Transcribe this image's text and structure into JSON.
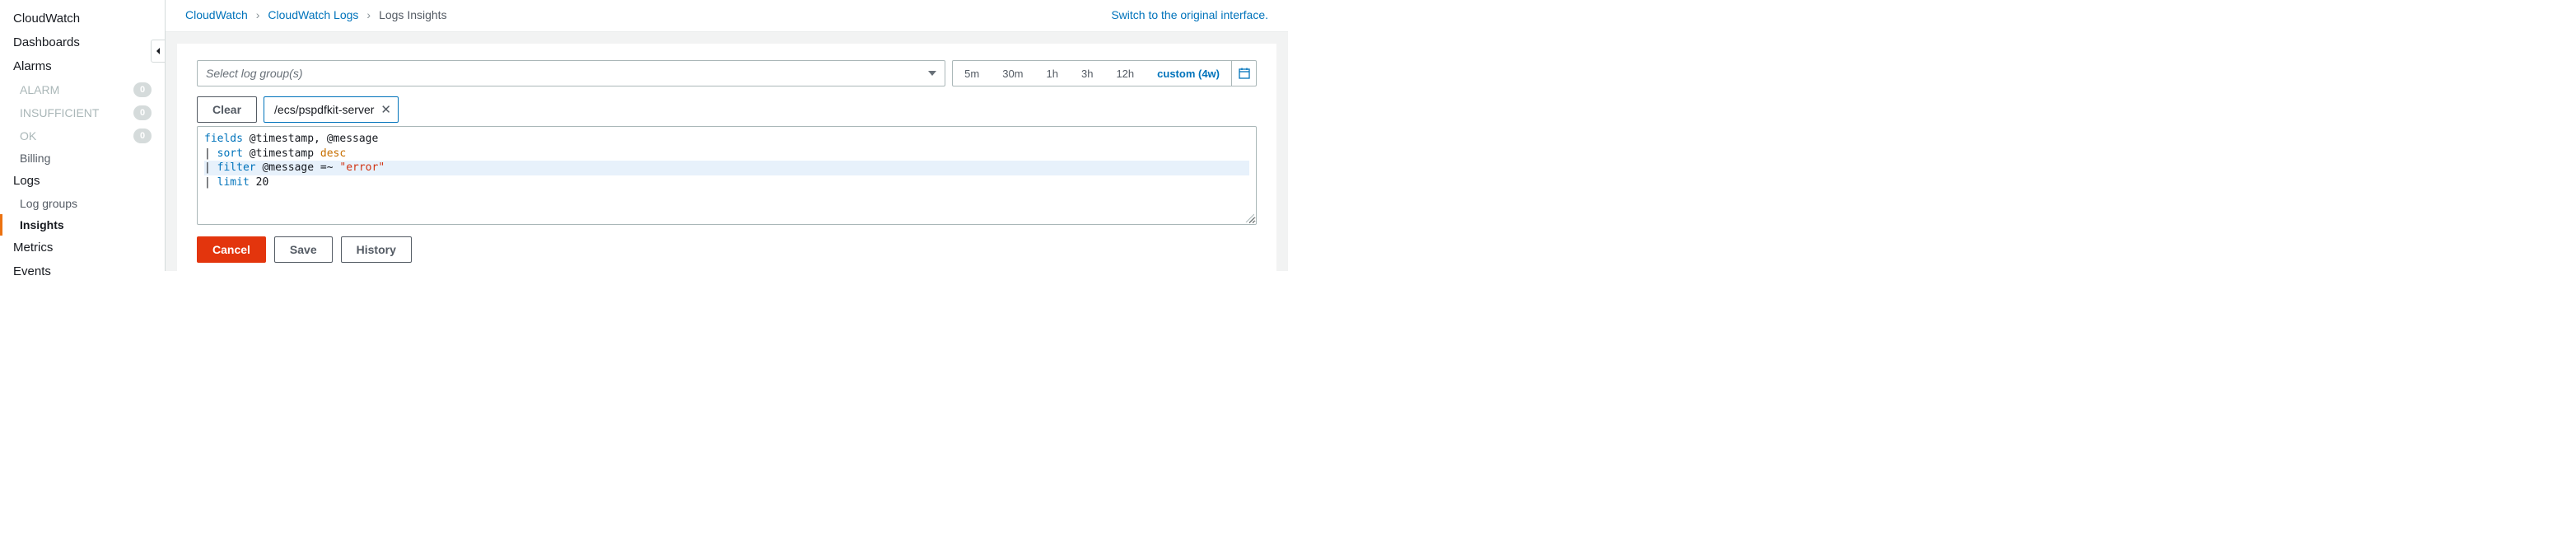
{
  "sidebar": {
    "items": [
      {
        "label": "CloudWatch",
        "type": "item"
      },
      {
        "label": "Dashboards",
        "type": "item"
      },
      {
        "label": "Alarms",
        "type": "item"
      },
      {
        "label": "ALARM",
        "type": "sub-disabled",
        "count": "0"
      },
      {
        "label": "INSUFFICIENT",
        "type": "sub-disabled",
        "count": "0"
      },
      {
        "label": "OK",
        "type": "sub-disabled",
        "count": "0"
      },
      {
        "label": "Billing",
        "type": "sub"
      },
      {
        "label": "Logs",
        "type": "item"
      },
      {
        "label": "Log groups",
        "type": "sub"
      },
      {
        "label": "Insights",
        "type": "sub-active"
      },
      {
        "label": "Metrics",
        "type": "item"
      },
      {
        "label": "Events",
        "type": "item"
      }
    ]
  },
  "breadcrumb": {
    "items": [
      "CloudWatch",
      "CloudWatch Logs",
      "Logs Insights"
    ]
  },
  "top_link": "Switch to the original interface.",
  "log_select": {
    "placeholder": "Select log group(s)"
  },
  "time_range": {
    "options": [
      "5m",
      "30m",
      "1h",
      "3h",
      "12h"
    ],
    "custom": "custom (4w)"
  },
  "clear_label": "Clear",
  "chip": {
    "label": "/ecs/pspdfkit-server"
  },
  "query": {
    "line1": {
      "kw": "fields",
      "rest": " @timestamp, @message"
    },
    "line2": {
      "pipe": "| ",
      "kw": "sort",
      "mid": " @timestamp ",
      "dir": "desc"
    },
    "line3": {
      "pipe": "| ",
      "kw": "filter",
      "mid": " @message =~ ",
      "str": "\"error\""
    },
    "line4": {
      "pipe": "| ",
      "kw": "limit",
      "rest": " 20"
    }
  },
  "actions": {
    "cancel": "Cancel",
    "save": "Save",
    "history": "History"
  }
}
